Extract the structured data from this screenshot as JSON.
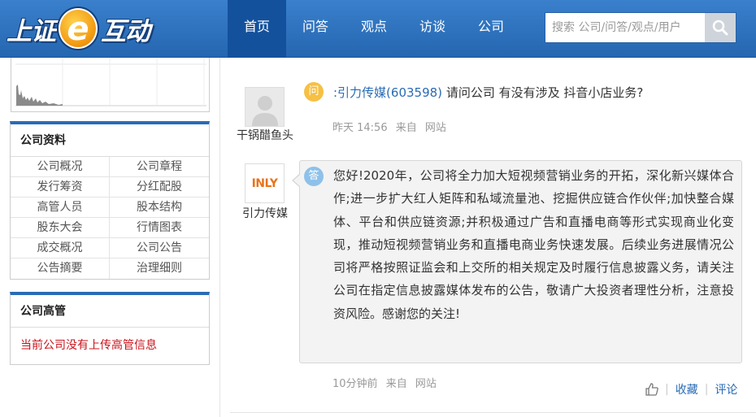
{
  "logo": {
    "part1": "上证",
    "e": "e",
    "part2": "互动"
  },
  "nav": [
    "首页",
    "问答",
    "观点",
    "访谈",
    "公司"
  ],
  "search": {
    "placeholder": "搜索 公司/问答/观点/用户"
  },
  "company_panel": {
    "title": "公司资料",
    "links": [
      "公司概况",
      "公司章程",
      "发行筹资",
      "分红配股",
      "高管人员",
      "股本结构",
      "股东大会",
      "行情图表",
      "成交概况",
      "公司公告",
      "公告摘要",
      "治理细则"
    ]
  },
  "exec_panel": {
    "title": "公司高管",
    "note": "当前公司没有上传高管信息"
  },
  "question": {
    "badge": "问",
    "asker": "干锅醋鱼头",
    "stock": ":引力传媒(603598)",
    "text": "请问公司 有没有涉及 抖音小店业务?",
    "time": "昨天 14:56",
    "source_prefix": "来自",
    "source": "网站"
  },
  "answer": {
    "badge": "答",
    "company": "引力传媒",
    "logo_text": "INLY",
    "text": "您好!2020年，公司将全力加大短视频营销业务的开拓，深化新兴媒体合作;进一步扩大红人矩阵和私域流量池、挖掘供应链合作伙伴;加快整合媒体、平台和供应链资源;并积极通过广告和直播电商等形式实现商业化变现，推动短视频营销业务和直播电商业务快速发展。后续业务进展情况公司将严格按照证监会和上交所的相关规定及时履行信息披露义务，请关注公司在指定信息披露媒体发布的公告，敬请广大投资者理性分析，注意投资风险。感谢您的关注!",
    "time": "10分钟前",
    "source_prefix": "来自",
    "source": "网站"
  },
  "actions": {
    "collect": "收藏",
    "comment": "评论"
  },
  "colors": {
    "header": "#2f74c0",
    "nav_active": "#14519c",
    "accent": "#2a6bb5",
    "alert": "#c9141d"
  }
}
